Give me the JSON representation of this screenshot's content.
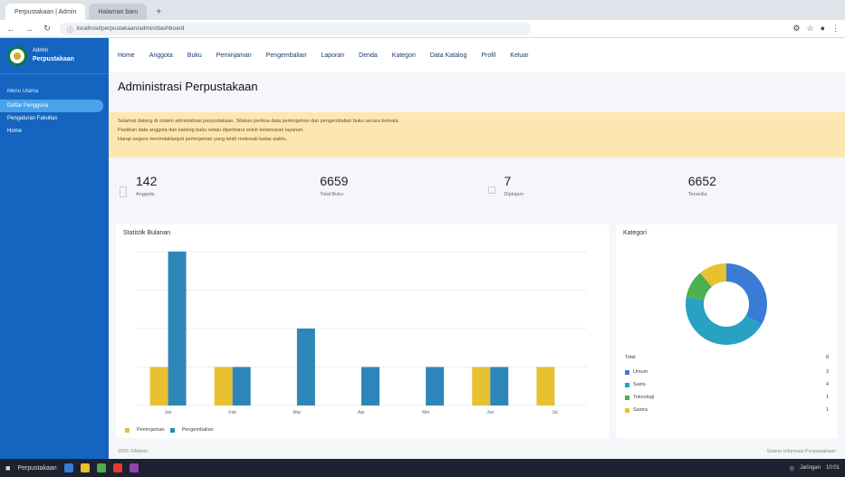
{
  "browser": {
    "tabs": [
      "Perpustakaan | Admin",
      "Halaman baru"
    ],
    "new_tab": "+",
    "address": "localhost/perpustakaan/admin/dashboard",
    "icons": [
      "back-icon",
      "forward-icon",
      "reload-icon",
      "secure-icon"
    ]
  },
  "sidebar": {
    "brand_top": "Admin",
    "brand_name": "Perpustakaan",
    "section": "Menu Utama",
    "items": [
      "Daftar Pengguna",
      "Pengaturan Fakultas",
      "Home"
    ]
  },
  "topnav": [
    "Home",
    "Anggota",
    "Buku",
    "Peminjaman",
    "Pengembalian",
    "Laporan",
    "Denda",
    "Kategori",
    "Data Katalog",
    "Profil",
    "Keluar"
  ],
  "page": {
    "title": "Administrasi Perpustakaan"
  },
  "alert": {
    "line1": "Selamat datang di sistem administrasi perpustakaan. Silakan periksa data peminjaman dan pengembalian buku secara berkala.",
    "line2": "Pastikan data anggota dan katalog buku selalu diperbarui untuk kelancaran layanan.",
    "line3": "Harap segera menindaklanjuti peminjaman yang telah melewati batas waktu."
  },
  "stats": [
    {
      "value": "142",
      "label": "Anggota"
    },
    {
      "value": "6659",
      "label": "Total Buku"
    },
    {
      "value": "7",
      "label": "Dipinjam"
    },
    {
      "value": "6652",
      "label": "Tersedia"
    }
  ],
  "chart_card": {
    "title": "Statistik Bulanan",
    "legend": [
      "Peminjaman",
      "Pengembalian"
    ]
  },
  "donut_card": {
    "title": "Kategori",
    "header_label": "Total",
    "header_value": "8",
    "rows": [
      {
        "label": "Umum",
        "value": "3",
        "color": "#3a7bd5"
      },
      {
        "label": "Sains",
        "value": "4",
        "color": "#27a2c2"
      },
      {
        "label": "Teknologi",
        "value": "1",
        "color": "#4caf50"
      },
      {
        "label": "Sastra",
        "value": "1",
        "color": "#e7c12f"
      }
    ]
  },
  "chart_data": {
    "type": "bar",
    "categories": [
      "Jan",
      "Feb",
      "Mar",
      "Apr",
      "Mei",
      "Jun",
      "Jul"
    ],
    "series": [
      {
        "name": "Peminjaman",
        "values": [
          1,
          1,
          0,
          0,
          0,
          1,
          1
        ],
        "color": "#e7c12f"
      },
      {
        "name": "Pengembalian",
        "values": [
          4,
          1,
          2,
          1,
          1,
          1,
          0
        ],
        "color": "#2e86b8"
      }
    ],
    "ylim": [
      0,
      4
    ]
  },
  "footer": {
    "left": "2025 ©Admin",
    "right": "Sistem Informasi Perpustakaan"
  },
  "taskbar": {
    "window_label": "Perpustakaan",
    "status": "Jaringan",
    "time": "10:01"
  }
}
